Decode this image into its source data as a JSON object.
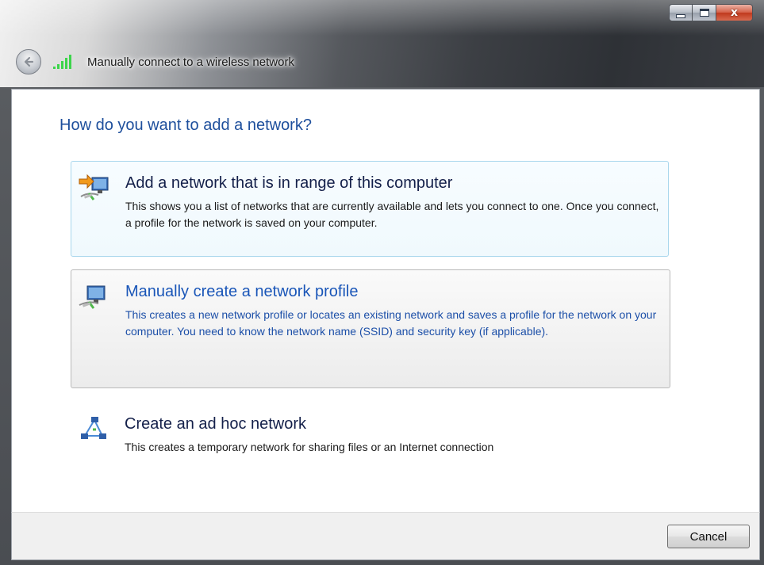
{
  "window": {
    "title": "Manually connect to a wireless network",
    "caption_buttons": {
      "minimize_icon": "minimize-icon",
      "maximize_icon": "maximize-icon",
      "close_glyph": "x"
    }
  },
  "nav": {
    "back_icon": "back-arrow-icon",
    "network_icon": "wireless-signal-icon"
  },
  "main": {
    "heading": "How do you want to add a network?",
    "options": [
      {
        "title": "Add a network that is in range of this computer",
        "description": "This shows you a list of networks that are currently available and lets you connect to one. Once you connect, a profile for the network is saved on your computer.",
        "icon": "network-add-icon",
        "state": "default"
      },
      {
        "title": "Manually create a network profile",
        "description": "This creates a new network profile or locates an existing network and saves a profile for the network on your computer. You need to know the network name (SSID) and security key (if applicable).",
        "icon": "network-profile-icon",
        "state": "hovered"
      },
      {
        "title": "Create an ad hoc network",
        "description": "This creates a temporary network for sharing files or an Internet connection",
        "icon": "ad-hoc-network-icon",
        "state": "default"
      }
    ]
  },
  "footer": {
    "cancel_label": "Cancel"
  },
  "colors": {
    "heading": "#1e4f9c",
    "link_hover": "#1a56b8",
    "option_border": "#a8d6ec"
  }
}
